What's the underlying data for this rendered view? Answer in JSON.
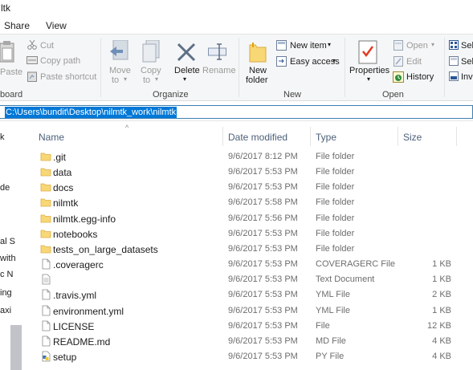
{
  "window": {
    "title": "ltk"
  },
  "tabs": [
    "Share",
    "View"
  ],
  "ribbon": {
    "clipboard": {
      "paste": "Paste",
      "cut": "Cut",
      "copy_path": "Copy path",
      "paste_shortcut": "Paste shortcut",
      "group": "board"
    },
    "organize": {
      "move_to": [
        "Move",
        "to"
      ],
      "copy_to": [
        "Copy",
        "to"
      ],
      "delete": "Delete",
      "rename": "Rename",
      "group": "Organize"
    },
    "new": {
      "new_folder": [
        "New",
        "folder"
      ],
      "new_item": "New item",
      "easy_access": "Easy access",
      "group": "New"
    },
    "open": {
      "properties": "Properties",
      "open": "Open",
      "edit": "Edit",
      "history": "History",
      "group": "Open"
    },
    "select": {
      "items": [
        "Sel",
        "Sel",
        "Inv"
      ]
    }
  },
  "address": {
    "path": "C:\\Users\\bundit\\Desktop\\nilmtk_work\\nilmtk"
  },
  "navpane": {
    "items": [
      "k",
      "de",
      "al S",
      "with",
      "c N",
      "ing",
      "axi"
    ]
  },
  "columns": {
    "name": "Name",
    "date": "Date modified",
    "type": "Type",
    "size": "Size"
  },
  "files": [
    {
      "name": ".git",
      "date": "9/6/2017 8:12 PM",
      "type": "File folder",
      "size": "",
      "icon": "folder"
    },
    {
      "name": "data",
      "date": "9/6/2017 5:53 PM",
      "type": "File folder",
      "size": "",
      "icon": "folder"
    },
    {
      "name": "docs",
      "date": "9/6/2017 5:53 PM",
      "type": "File folder",
      "size": "",
      "icon": "folder"
    },
    {
      "name": "nilmtk",
      "date": "9/6/2017 5:58 PM",
      "type": "File folder",
      "size": "",
      "icon": "folder"
    },
    {
      "name": "nilmtk.egg-info",
      "date": "9/6/2017 5:56 PM",
      "type": "File folder",
      "size": "",
      "icon": "folder"
    },
    {
      "name": "notebooks",
      "date": "9/6/2017 5:53 PM",
      "type": "File folder",
      "size": "",
      "icon": "folder"
    },
    {
      "name": "tests_on_large_datasets",
      "date": "9/6/2017 5:53 PM",
      "type": "File folder",
      "size": "",
      "icon": "folder"
    },
    {
      "name": ".coveragerc",
      "date": "9/6/2017 5:53 PM",
      "type": "COVERAGERC File",
      "size": "1 KB",
      "icon": "file"
    },
    {
      "name": "",
      "date": "9/6/2017 5:53 PM",
      "type": "Text Document",
      "size": "1 KB",
      "icon": "text"
    },
    {
      "name": ".travis.yml",
      "date": "9/6/2017 5:53 PM",
      "type": "YML File",
      "size": "2 KB",
      "icon": "file"
    },
    {
      "name": "environment.yml",
      "date": "9/6/2017 5:53 PM",
      "type": "YML File",
      "size": "1 KB",
      "icon": "file"
    },
    {
      "name": "LICENSE",
      "date": "9/6/2017 5:53 PM",
      "type": "File",
      "size": "12 KB",
      "icon": "file"
    },
    {
      "name": "README.md",
      "date": "9/6/2017 5:53 PM",
      "type": "MD File",
      "size": "4 KB",
      "icon": "file"
    },
    {
      "name": "setup",
      "date": "9/6/2017 5:53 PM",
      "type": "PY File",
      "size": "4 KB",
      "icon": "python"
    }
  ],
  "colors": {
    "accent": "#0078d7",
    "folder": "#f8d775",
    "folder_dark": "#e8b84a",
    "header_text": "#4c607a"
  }
}
